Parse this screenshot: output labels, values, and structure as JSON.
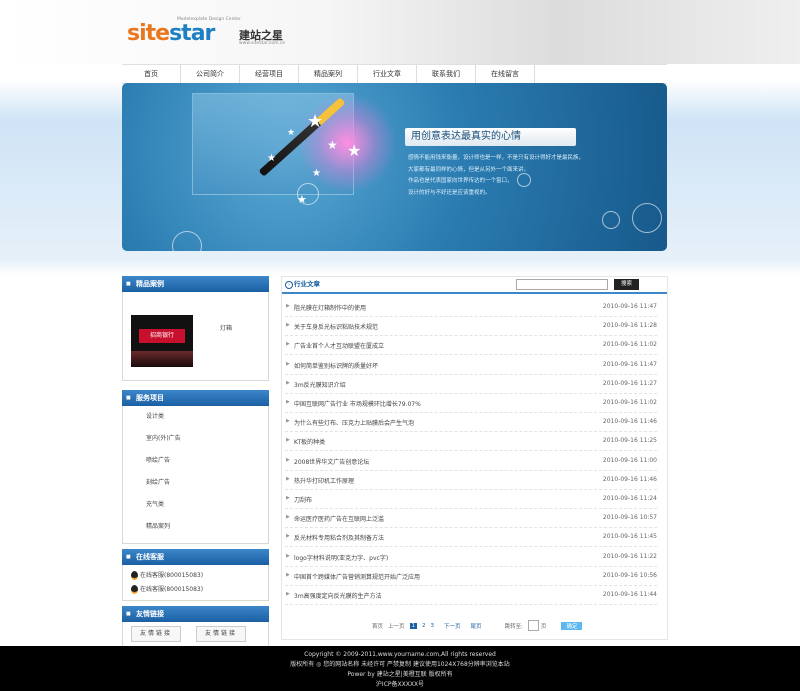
{
  "header": {
    "logo_text_orange": "site",
    "logo_text_blue": "star",
    "logo_cn": "建站之星",
    "logo_sub": "Modelexplate Design Center",
    "logo_url": "www.sitestar.com.cn"
  },
  "nav": [
    "首页",
    "公司简介",
    "经营项目",
    "精品案列",
    "行业文章",
    "联系我们",
    "在线留言"
  ],
  "banner": {
    "title": "用创意表达最真实的心情",
    "lines": [
      "感情不能用钱来衡量，设计师也是一样，不是只有设计得好才是最民族，",
      "大家都有最同样的心情，但是从另外一个面来讲，",
      "作品也是代表国家向世界传达的一个窗口，",
      "设计的好与不好还是应该重视的。"
    ]
  },
  "sidebar": {
    "products_title": "精品案例",
    "product_label": "灯箱",
    "product_sign": "招商银行",
    "services_title": "服务项目",
    "services": [
      "设计类",
      "室内(外)广告",
      "喷绘广告",
      "刻绘广告",
      "充气类",
      "精品案列"
    ],
    "support_title": "在线客服",
    "support": [
      "在线客服(800015083)",
      "在线客服(800015083)"
    ],
    "links_title": "友情链接",
    "links": [
      "友情链接",
      "友情链接"
    ]
  },
  "main": {
    "title": "行业文章",
    "search_button": "搜索",
    "articles": [
      {
        "title": "阻光膜在灯箱制作中的使用",
        "date": "2010-09-16 11:47"
      },
      {
        "title": "关于车身反光标识粘贴技术规范",
        "date": "2010-09-16 11:28"
      },
      {
        "title": "广告业首个人才互动联盟在厦成立",
        "date": "2010-09-16 11:02"
      },
      {
        "title": "如何简单鉴别标识牌的质量好坏",
        "date": "2010-09-16 11:47"
      },
      {
        "title": "3m反光膜知识介绍",
        "date": "2010-09-16 11:27"
      },
      {
        "title": "中国互联网广告行业  市场规模环比增长79.07%",
        "date": "2010-09-16 11:02"
      },
      {
        "title": "为什么有些灯布、压克力上贴膜后会产生气泡",
        "date": "2010-09-16 11:46"
      },
      {
        "title": "KT板的种类",
        "date": "2010-09-16 11:25"
      },
      {
        "title": "2008世界华文广告创意论坛",
        "date": "2010-09-16 11:00"
      },
      {
        "title": "热升华打印机工作原理",
        "date": "2010-09-16 11:46"
      },
      {
        "title": "刀刮布",
        "date": "2010-09-16 11:24"
      },
      {
        "title": "命运医疗医药广告在互联网上泛滥",
        "date": "2010-09-16 10:57"
      },
      {
        "title": "反光材料专用粘合剂及其制备方法",
        "date": "2010-09-16 11:45"
      },
      {
        "title": "logo字材料说明(亚克力字、pvc字)",
        "date": "2010-09-16 11:22"
      },
      {
        "title": "中国首个跨媒体广告营销测算规范开始广泛应用",
        "date": "2010-09-16 10:56"
      },
      {
        "title": "3m高强度定向反光膜的生产方法",
        "date": "2010-09-16 11:44"
      }
    ],
    "pager": {
      "first": "首页",
      "prev": "上一页",
      "pages": [
        "1",
        "2",
        "3"
      ],
      "next": "下一页",
      "last": "尾页",
      "jump_label": "跳转至:",
      "page_unit": "页",
      "go": "确定"
    }
  },
  "footer": [
    "Copyright © 2009-2011,www.yourname.com,All rights reserved",
    "版权所有 ◎ 您的网站名称  未经许可  严禁复制  建议使用1024X768分辨率浏览本站",
    "Power by 建站之星|美橙互联 版权所有",
    "沪ICP备XXXXX号"
  ]
}
